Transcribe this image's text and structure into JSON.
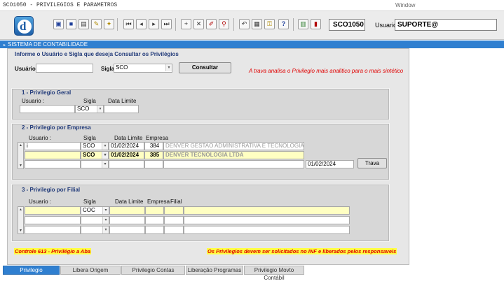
{
  "window": {
    "title": "SCO1050 - PRIVILEGIOS E PARAMETROS",
    "menu": "Window"
  },
  "toolbar": {
    "logo_letter": "d",
    "buttons": [
      "save-icon",
      "stop-icon",
      "print-preview-icon",
      "wand-icon",
      "help-tool-icon",
      "first-record-icon",
      "prev-record-icon",
      "next-record-icon",
      "last-record-icon",
      "add-record-icon",
      "delete-record-icon",
      "edit-record-icon",
      "search-record-icon",
      "undo-icon",
      "calculator-icon",
      "key-icon",
      "question-icon",
      "calendar-icon",
      "exit-icon"
    ],
    "form_code": "SCO1050",
    "user_label": "Usuario",
    "user_value": "SUPORTE@"
  },
  "section_title": "SISTEMA DE CONTABILIDADE",
  "query": {
    "title": "Informe o Usuário e Sigla que deseja Consultar os Privilégios",
    "usuario_label": "Usuário",
    "usuario_value": "",
    "sigla_label": "Sigla",
    "sigla_value": "SCO",
    "consultar_label": "Consultar",
    "note": "A trava analisa o Privilegio mais analitico para o mais sintético"
  },
  "geral": {
    "title": "1 - Privilegio Geral",
    "col_usuario": "Usuario :",
    "col_sigla": "Sigla",
    "col_data": "Data Limite",
    "row": {
      "usuario": "",
      "sigla": "SCO",
      "data": ""
    }
  },
  "empresa": {
    "title": "2 - Privilegio por Empresa",
    "col_usuario": "Usuario :",
    "col_sigla": "Sigla",
    "col_data": "Data Limite",
    "col_empresa": "Empresa",
    "rows": [
      {
        "usuario": "i",
        "sigla": "SCO",
        "data": "01/02/2024",
        "empresa": "384",
        "nome": "DENVER GESTAO ADMINISTRATIVA E TECNOLOGIA LTDA"
      },
      {
        "usuario": "",
        "sigla": "SCO",
        "data": "01/02/2024",
        "empresa": "385",
        "nome": "DENVER TECNOLOGIA LTDA"
      },
      {
        "usuario": "",
        "sigla": "",
        "data": "",
        "empresa": "",
        "nome": ""
      }
    ],
    "trava_date": "01/02/2024",
    "trava_label": "Trava"
  },
  "filial": {
    "title": "3 - Privilegio por Filial",
    "col_usuario": "Usuario :",
    "col_sigla": "Sigla",
    "col_data": "Data Limite",
    "col_empresa": "Empresa",
    "col_filial": "Filial",
    "rows": [
      {
        "usuario": "",
        "sigla": "COC",
        "data": "",
        "empresa": "",
        "filial": "",
        "nome": ""
      },
      {
        "usuario": "",
        "sigla": "",
        "data": "",
        "empresa": "",
        "filial": "",
        "nome": ""
      },
      {
        "usuario": "",
        "sigla": "",
        "data": "",
        "empresa": "",
        "filial": "",
        "nome": ""
      }
    ]
  },
  "footer_notes": {
    "left": "Controle 613 - Privilégio a Aba",
    "right": "Os Privilegios devem ser solicitados no INF e liberados pelos responsaveis"
  },
  "tabs": [
    "Privilegio",
    "Libera Origem",
    "Privilegio Contas",
    "Liberação Programas",
    "Privilegio Movto Contábil"
  ],
  "colors": {
    "accent": "#2f7fd0",
    "header_text": "#223b7a",
    "note_red": "#e00000",
    "highlight": "#ffff40",
    "row_yellow": "#ffffc2"
  }
}
